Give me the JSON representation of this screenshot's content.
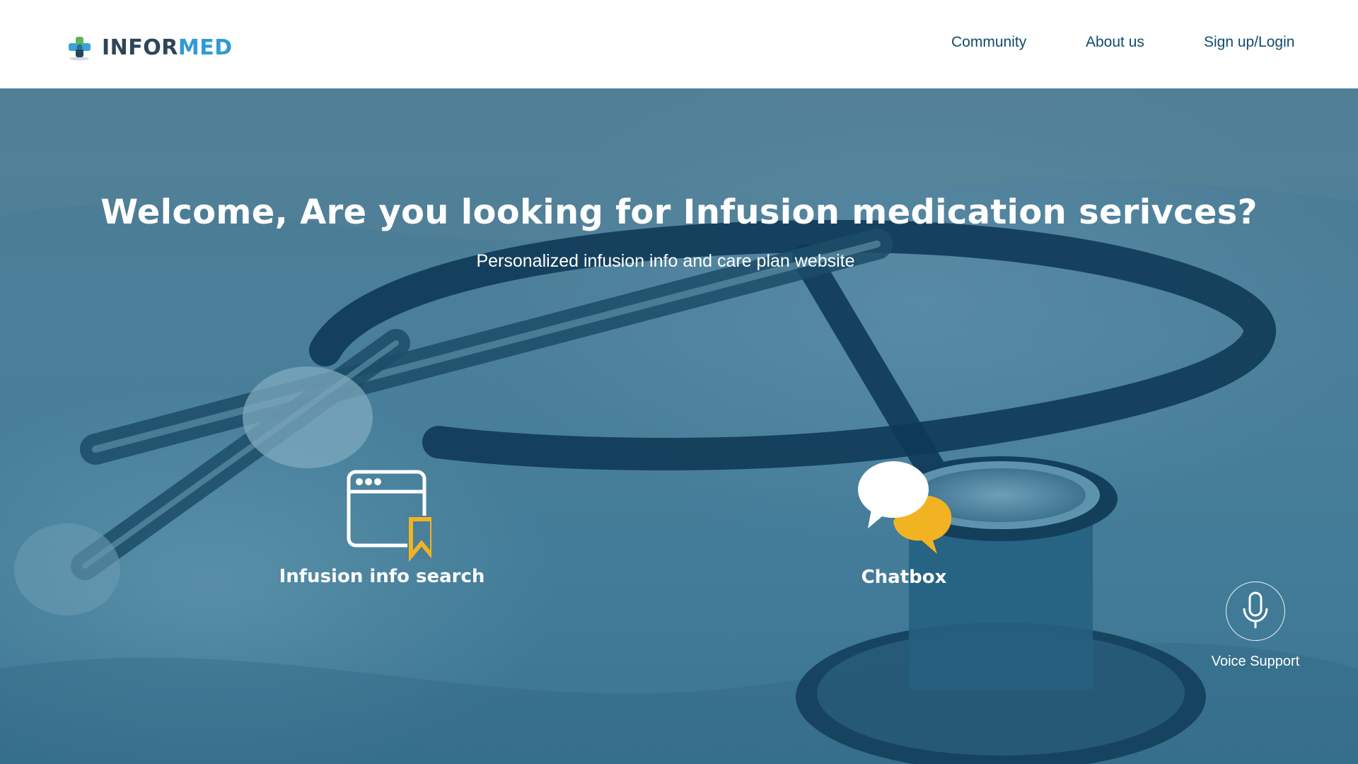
{
  "brand": {
    "name_part1": "INFOR",
    "name_part2": "MED",
    "color_dark": "#2e4457",
    "color_accent": "#2f9bd3",
    "logo_icon": "puzzle-cross-logo"
  },
  "nav": {
    "community": "Community",
    "about": "About us",
    "signup": "Sign up/Login",
    "color": "#0f4c6e"
  },
  "hero": {
    "title": "Welcome, Are you looking for Infusion medication serivces?",
    "subtitle": "Personalized infusion info and care plan website",
    "background_image": "stethoscope-photo-blue-tint",
    "tint_color": "#3f7893"
  },
  "features": {
    "search": {
      "label": "Infusion info search",
      "icon": "browser-bookmark-icon"
    },
    "chat": {
      "label": "Chatbox",
      "icon": "chat-bubbles-icon"
    },
    "voice": {
      "label": "Voice Support",
      "icon": "microphone-icon"
    },
    "accent_color": "#f2b322"
  }
}
